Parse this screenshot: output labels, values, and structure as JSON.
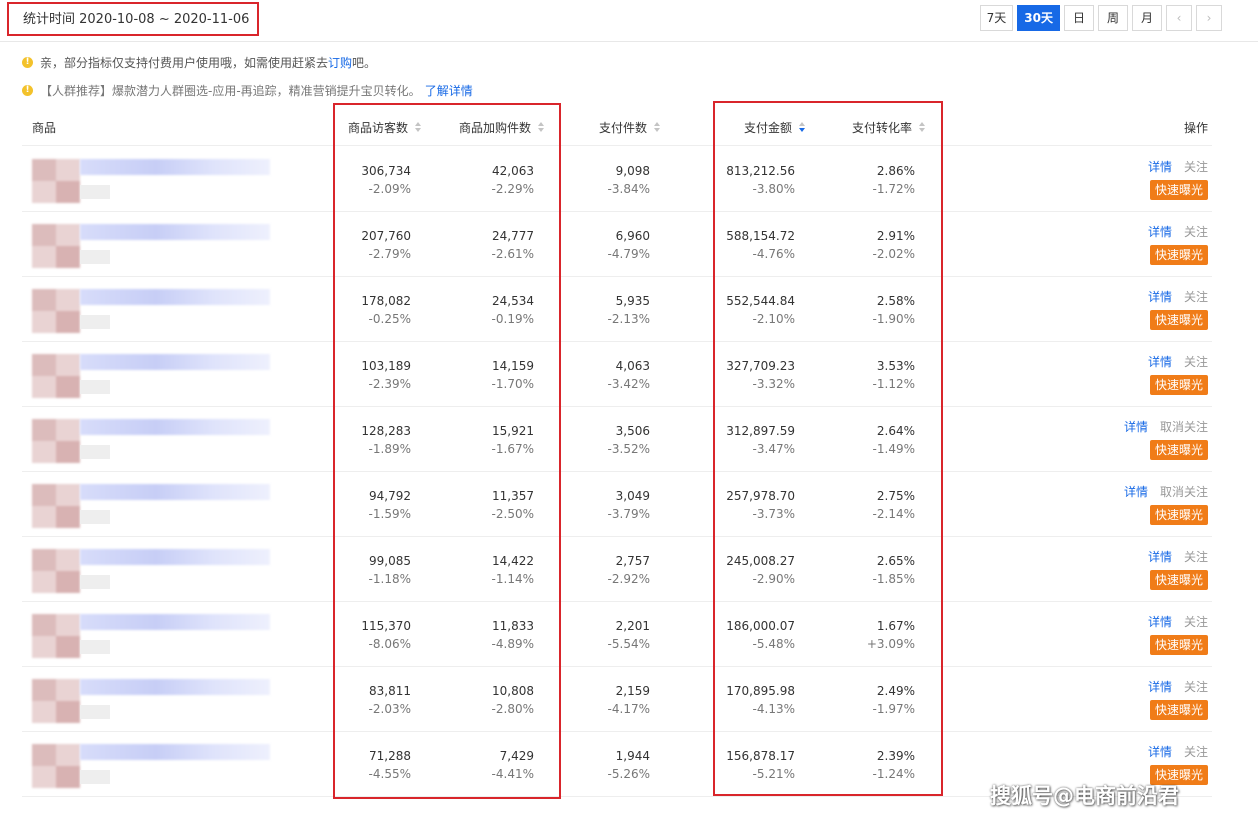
{
  "stat_range": "统计时间 2020-10-08 ~ 2020-11-06",
  "range_buttons": [
    {
      "label": "7天",
      "active": false
    },
    {
      "label": "30天",
      "active": true
    },
    {
      "label": "日",
      "active": false
    },
    {
      "label": "周",
      "active": false
    },
    {
      "label": "月",
      "active": false
    }
  ],
  "notices": [
    {
      "pre": "亲，部分指标仅支持付费用户使用哦，如需使用赶紧去 ",
      "link": "订购",
      "post": "吧。"
    },
    {
      "pre": "【人群推荐】",
      "mid": "爆款潜力人群圈选-应用-再追踪，精准营销提升宝贝转化。",
      "link": "了解详情"
    }
  ],
  "columns": {
    "product": "商品",
    "visitors": "商品访客数",
    "cart": "商品加购件数",
    "paid_qty": "支付件数",
    "paid_amount": "支付金额",
    "conversion": "支付转化率",
    "ops": "操作"
  },
  "rows": [
    {
      "visitors": "306,734",
      "visitors_chg": "-2.09%",
      "cart": "42,063",
      "cart_chg": "-2.29%",
      "paid_qty": "9,098",
      "paid_qty_chg": "-3.84%",
      "amount": "813,212.56",
      "amount_chg": "-3.80%",
      "conv": "2.86%",
      "conv_chg": "-1.72%",
      "detail": "详情",
      "follow": "关注",
      "expose": "快速曝光"
    },
    {
      "visitors": "207,760",
      "visitors_chg": "-2.79%",
      "cart": "24,777",
      "cart_chg": "-2.61%",
      "paid_qty": "6,960",
      "paid_qty_chg": "-4.79%",
      "amount": "588,154.72",
      "amount_chg": "-4.76%",
      "conv": "2.91%",
      "conv_chg": "-2.02%",
      "detail": "详情",
      "follow": "关注",
      "expose": "快速曝光"
    },
    {
      "visitors": "178,082",
      "visitors_chg": "-0.25%",
      "cart": "24,534",
      "cart_chg": "-0.19%",
      "paid_qty": "5,935",
      "paid_qty_chg": "-2.13%",
      "amount": "552,544.84",
      "amount_chg": "-2.10%",
      "conv": "2.58%",
      "conv_chg": "-1.90%",
      "detail": "详情",
      "follow": "关注",
      "expose": "快速曝光"
    },
    {
      "visitors": "103,189",
      "visitors_chg": "-2.39%",
      "cart": "14,159",
      "cart_chg": "-1.70%",
      "paid_qty": "4,063",
      "paid_qty_chg": "-3.42%",
      "amount": "327,709.23",
      "amount_chg": "-3.32%",
      "conv": "3.53%",
      "conv_chg": "-1.12%",
      "detail": "详情",
      "follow": "关注",
      "expose": "快速曝光"
    },
    {
      "visitors": "128,283",
      "visitors_chg": "-1.89%",
      "cart": "15,921",
      "cart_chg": "-1.67%",
      "paid_qty": "3,506",
      "paid_qty_chg": "-3.52%",
      "amount": "312,897.59",
      "amount_chg": "-3.47%",
      "conv": "2.64%",
      "conv_chg": "-1.49%",
      "detail": "详情",
      "follow": "取消关注",
      "expose": "快速曝光"
    },
    {
      "visitors": "94,792",
      "visitors_chg": "-1.59%",
      "cart": "11,357",
      "cart_chg": "-2.50%",
      "paid_qty": "3,049",
      "paid_qty_chg": "-3.79%",
      "amount": "257,978.70",
      "amount_chg": "-3.73%",
      "conv": "2.75%",
      "conv_chg": "-2.14%",
      "detail": "详情",
      "follow": "取消关注",
      "expose": "快速曝光"
    },
    {
      "visitors": "99,085",
      "visitors_chg": "-1.18%",
      "cart": "14,422",
      "cart_chg": "-1.14%",
      "paid_qty": "2,757",
      "paid_qty_chg": "-2.92%",
      "amount": "245,008.27",
      "amount_chg": "-2.90%",
      "conv": "2.65%",
      "conv_chg": "-1.85%",
      "detail": "详情",
      "follow": "关注",
      "expose": "快速曝光"
    },
    {
      "visitors": "115,370",
      "visitors_chg": "-8.06%",
      "cart": "11,833",
      "cart_chg": "-4.89%",
      "paid_qty": "2,201",
      "paid_qty_chg": "-5.54%",
      "amount": "186,000.07",
      "amount_chg": "-5.48%",
      "conv": "1.67%",
      "conv_chg": "+3.09%",
      "detail": "详情",
      "follow": "关注",
      "expose": "快速曝光"
    },
    {
      "visitors": "83,811",
      "visitors_chg": "-2.03%",
      "cart": "10,808",
      "cart_chg": "-2.80%",
      "paid_qty": "2,159",
      "paid_qty_chg": "-4.17%",
      "amount": "170,895.98",
      "amount_chg": "-4.13%",
      "conv": "2.49%",
      "conv_chg": "-1.97%",
      "detail": "详情",
      "follow": "关注",
      "expose": "快速曝光"
    },
    {
      "visitors": "71,288",
      "visitors_chg": "-4.55%",
      "cart": "7,429",
      "cart_chg": "-4.41%",
      "paid_qty": "1,944",
      "paid_qty_chg": "-5.26%",
      "amount": "156,878.17",
      "amount_chg": "-5.21%",
      "conv": "2.39%",
      "conv_chg": "-1.24%",
      "detail": "详情",
      "follow": "关注",
      "expose": "快速曝光"
    }
  ],
  "watermark": "搜狐号@电商前沿君",
  "colors": {
    "accent": "#1769e6",
    "highlight_box": "#d9252b",
    "expose_btn": "#f07c18",
    "notice_dot": "#f3c22b"
  }
}
